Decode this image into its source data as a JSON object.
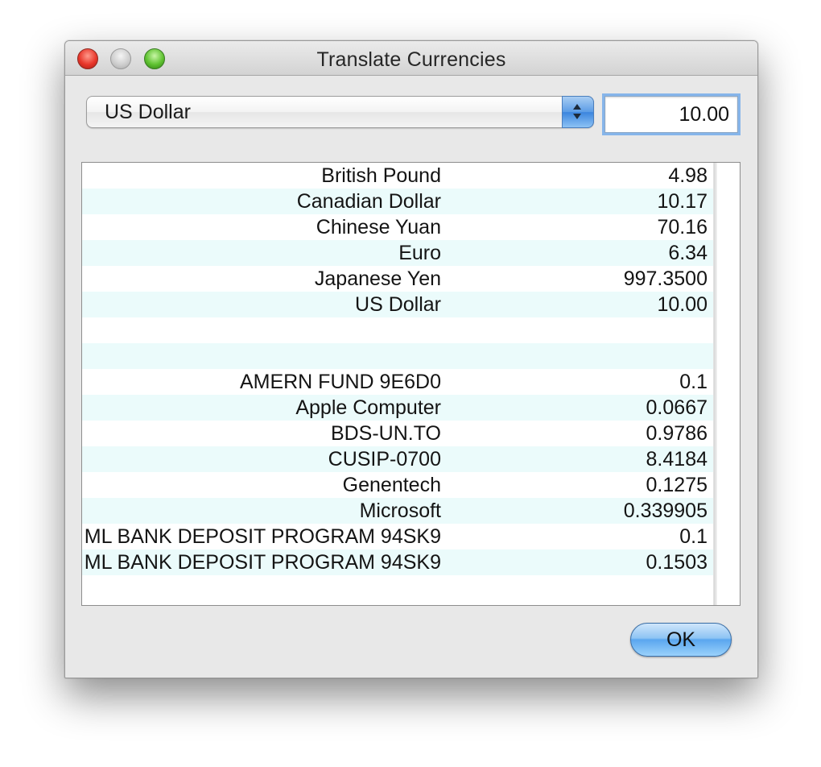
{
  "window": {
    "title": "Translate Currencies"
  },
  "controls": {
    "currency_selected": "US Dollar",
    "amount": "10.00"
  },
  "table": {
    "rows": [
      {
        "name": "British Pound",
        "value": "4.98"
      },
      {
        "name": "Canadian Dollar",
        "value": "10.17"
      },
      {
        "name": "Chinese Yuan",
        "value": "70.16"
      },
      {
        "name": "Euro",
        "value": "6.34"
      },
      {
        "name": "Japanese Yen",
        "value": "997.3500"
      },
      {
        "name": "US Dollar",
        "value": "10.00"
      },
      {
        "name": "",
        "value": ""
      },
      {
        "name": "",
        "value": ""
      },
      {
        "name": "AMERN FUND 9E6D0",
        "value": "0.1"
      },
      {
        "name": "Apple Computer",
        "value": "0.0667"
      },
      {
        "name": "BDS-UN.TO",
        "value": "0.9786"
      },
      {
        "name": "CUSIP-0700",
        "value": "8.4184"
      },
      {
        "name": "Genentech",
        "value": "0.1275"
      },
      {
        "name": "Microsoft",
        "value": "0.339905"
      },
      {
        "name": "ML BANK DEPOSIT PROGRAM 94SK9",
        "value": "0.1"
      },
      {
        "name": "ML BANK DEPOSIT PROGRAM 94SK9",
        "value": "0.1503"
      }
    ]
  },
  "buttons": {
    "ok_label": "OK"
  },
  "colors": {
    "row_alt": "#ebfbfb",
    "accent": "#5aa6ef"
  }
}
